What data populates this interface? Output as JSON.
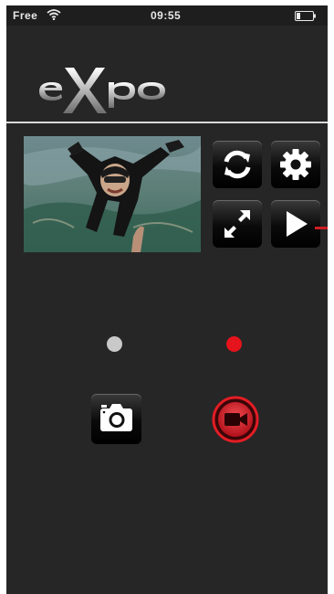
{
  "status_bar": {
    "carrier": "Free",
    "time": "09:55",
    "wifi_icon": "wifi-icon",
    "battery_icon": "battery-icon"
  },
  "logo": {
    "text": "eXpo"
  },
  "controls": {
    "icons": [
      "refresh-icon",
      "gear-icon",
      "fullscreen-icon",
      "play-icon"
    ]
  },
  "mode_indicators": [
    {
      "name": "photo-mode-dot",
      "color": "#c9c9c9"
    },
    {
      "name": "video-mode-dot",
      "color": "#e5131b"
    }
  ],
  "capture": {
    "photo_icon": "camera-icon",
    "video_icon": "video-camera-icon",
    "record_color": "#d7161f"
  }
}
